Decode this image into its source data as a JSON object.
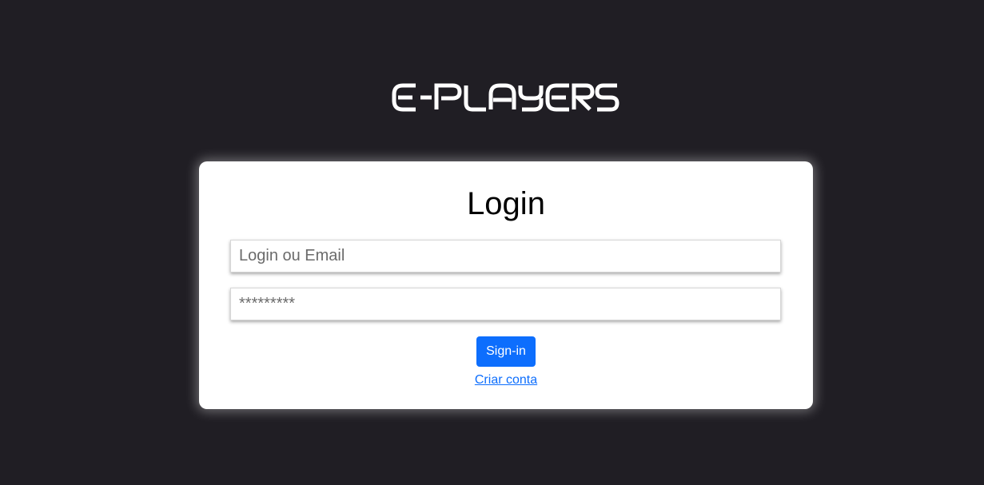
{
  "brand": {
    "logo_text": "E-PLAYERS"
  },
  "login_card": {
    "title": "Login",
    "login_field": {
      "placeholder": "Login ou Email",
      "value": ""
    },
    "password_field": {
      "placeholder": "*********",
      "value": ""
    },
    "signin_label": "Sign-in",
    "create_account_label": "Criar conta"
  },
  "colors": {
    "background": "#201e24",
    "card": "#ffffff",
    "primary": "#0d6efd"
  }
}
